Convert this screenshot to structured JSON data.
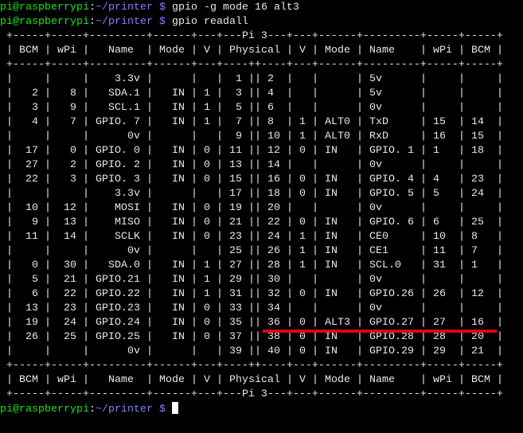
{
  "prompt": {
    "user_host": "pi@raspberrypi",
    "sep": ":",
    "path": "~/printer $",
    "colors": {
      "user": "#19e619",
      "path": "#8080ff"
    }
  },
  "commands": [
    "gpio -g mode 16 alt3",
    "gpio readall"
  ],
  "board_label": "Pi 3",
  "headers": {
    "left": [
      "BCM",
      "wPi",
      "Name",
      "Mode",
      "V"
    ],
    "physical": "Physical",
    "right": [
      "V",
      "Mode",
      "Name",
      "wPi",
      "BCM"
    ]
  },
  "rows": [
    [
      "",
      "",
      "3.3v",
      "",
      "",
      "1",
      "2",
      "",
      "",
      "5v",
      "",
      ""
    ],
    [
      "2",
      "8",
      "SDA.1",
      "IN",
      "1",
      "3",
      "4",
      "",
      "",
      "5v",
      "",
      ""
    ],
    [
      "3",
      "9",
      "SCL.1",
      "IN",
      "1",
      "5",
      "6",
      "",
      "",
      "0v",
      "",
      ""
    ],
    [
      "4",
      "7",
      "GPIO. 7",
      "IN",
      "1",
      "7",
      "8",
      "1",
      "ALT0",
      "TxD",
      "15",
      "14"
    ],
    [
      "",
      "",
      "0v",
      "",
      "",
      "9",
      "10",
      "1",
      "ALT0",
      "RxD",
      "16",
      "15"
    ],
    [
      "17",
      "0",
      "GPIO. 0",
      "IN",
      "0",
      "11",
      "12",
      "0",
      "IN",
      "GPIO. 1",
      "1",
      "18"
    ],
    [
      "27",
      "2",
      "GPIO. 2",
      "IN",
      "0",
      "13",
      "14",
      "",
      "",
      "0v",
      "",
      ""
    ],
    [
      "22",
      "3",
      "GPIO. 3",
      "IN",
      "0",
      "15",
      "16",
      "0",
      "IN",
      "GPIO. 4",
      "4",
      "23"
    ],
    [
      "",
      "",
      "3.3v",
      "",
      "",
      "17",
      "18",
      "0",
      "IN",
      "GPIO. 5",
      "5",
      "24"
    ],
    [
      "10",
      "12",
      "MOSI",
      "IN",
      "0",
      "19",
      "20",
      "",
      "",
      "0v",
      "",
      ""
    ],
    [
      "9",
      "13",
      "MISO",
      "IN",
      "0",
      "21",
      "22",
      "0",
      "IN",
      "GPIO. 6",
      "6",
      "25"
    ],
    [
      "11",
      "14",
      "SCLK",
      "IN",
      "0",
      "23",
      "24",
      "1",
      "IN",
      "CE0",
      "10",
      "8"
    ],
    [
      "",
      "",
      "0v",
      "",
      "",
      "25",
      "26",
      "1",
      "IN",
      "CE1",
      "11",
      "7"
    ],
    [
      "0",
      "30",
      "SDA.0",
      "IN",
      "1",
      "27",
      "28",
      "1",
      "IN",
      "SCL.0",
      "31",
      "1"
    ],
    [
      "5",
      "21",
      "GPIO.21",
      "IN",
      "1",
      "29",
      "30",
      "",
      "",
      "0v",
      "",
      ""
    ],
    [
      "6",
      "22",
      "GPIO.22",
      "IN",
      "1",
      "31",
      "32",
      "0",
      "IN",
      "GPIO.26",
      "26",
      "12"
    ],
    [
      "13",
      "23",
      "GPIO.23",
      "IN",
      "0",
      "33",
      "34",
      "",
      "",
      "0v",
      "",
      ""
    ],
    [
      "19",
      "24",
      "GPIO.24",
      "IN",
      "0",
      "35",
      "36",
      "0",
      "ALT3",
      "GPIO.27",
      "27",
      "16"
    ],
    [
      "26",
      "25",
      "GPIO.25",
      "IN",
      "0",
      "37",
      "38",
      "0",
      "IN",
      "GPIO.28",
      "28",
      "20"
    ],
    [
      "",
      "",
      "0v",
      "",
      "",
      "39",
      "40",
      "0",
      "IN",
      "GPIO.29",
      "29",
      "21"
    ]
  ],
  "highlight": {
    "row_physical": "36",
    "color": "#e00018"
  }
}
